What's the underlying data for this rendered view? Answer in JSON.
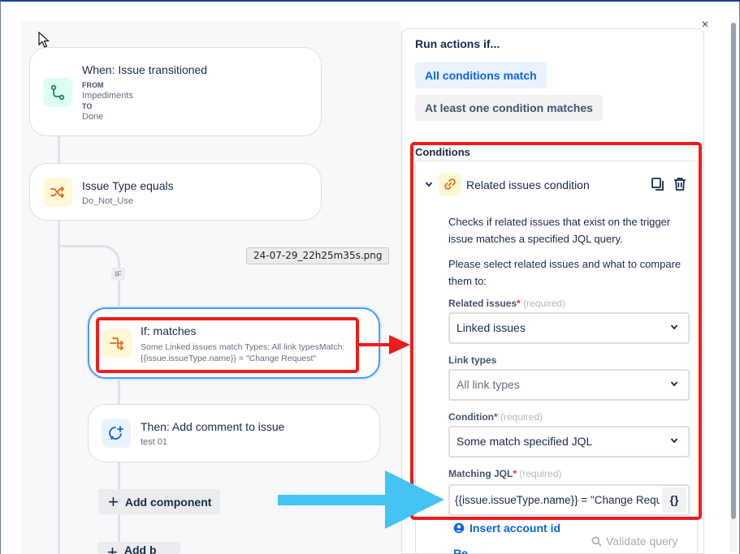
{
  "dialog": {
    "close_glyph": "×"
  },
  "canvas": {
    "trigger": {
      "title": "When: Issue transitioned",
      "from_label": "FROM",
      "from_value": "Impediments",
      "to_label": "TO",
      "to_value": "Done",
      "icon": "transition-icon",
      "icon_color": "#1f845a",
      "icon_bg": "#dcfff1"
    },
    "condition_card": {
      "title": "Issue Type equals",
      "subtitle": "Do_Not_Use",
      "icon": "shuffle-icon",
      "icon_color": "#e56910",
      "icon_bg": "#fff7d6"
    },
    "if_badge": "IF",
    "file_tooltip": "24-07-29_22h25m35s.png",
    "if_card": {
      "title": "If: matches",
      "line1": "Some Linked issues match Types: All link typesMatch:",
      "line2": "{{issue.issueType.name}} = \"Change Request\"",
      "icon": "branch-icon",
      "icon_color": "#e56910",
      "icon_bg": "#fff7d6"
    },
    "action_card": {
      "title": "Then: Add comment to issue",
      "subtitle": "test 01",
      "icon": "comment-add-icon",
      "icon_color": "#0c66e4",
      "icon_bg": "#e9f2ff"
    },
    "add_component_label": "Add component",
    "add_branch_label": "Add b"
  },
  "panel": {
    "run_title": "Run actions if...",
    "options": [
      {
        "label": "All conditions match",
        "selected": true
      },
      {
        "label": "At least one condition matches",
        "selected": false
      }
    ],
    "conditions_label": "Conditions",
    "condition": {
      "title": "Related issues condition",
      "description1": "Checks if related issues that exist on the trigger issue matches a specified JQL query.",
      "description2": "Please select related issues and what to compare them to:",
      "fields": {
        "related_issues": {
          "label": "Related issues",
          "required_note": "(required)",
          "value": "Linked issues"
        },
        "link_types": {
          "label": "Link types",
          "value": "All link types"
        },
        "condition": {
          "label": "Condition",
          "required_note": "(required)",
          "value": "Some match specified JQL"
        },
        "matching_jql": {
          "label": "Matching JQL",
          "required_note": "(required)",
          "value": "{{issue.issueType.name}} = \"Change Request\"",
          "smart_value_button": "{}"
        }
      },
      "insert_account_label": "Insert account id",
      "validate_label": "Validate query",
      "cutoff_label": "Re"
    }
  },
  "annotations": {
    "red_color": "#ee1c1c",
    "blue_arrow_color": "#45c3f2"
  }
}
